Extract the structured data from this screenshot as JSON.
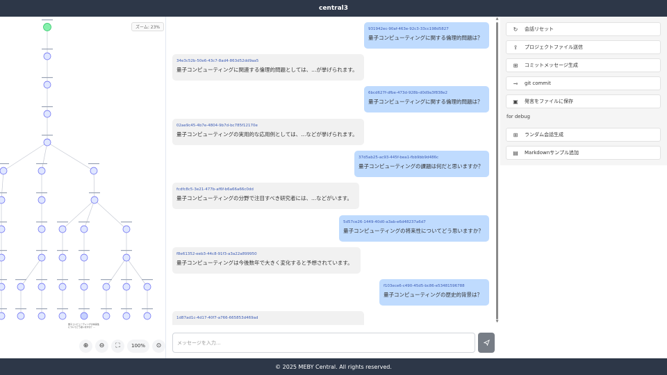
{
  "header": {
    "title": "central3"
  },
  "footer": {
    "text": "© 2025 MEBY Central. All rights reserved."
  },
  "tree": {
    "zoom_label": "ズーム: 23%",
    "controls": {
      "zoom_in": "⊕",
      "zoom_out": "⊖",
      "fit": "⛶",
      "percent": "100%",
      "center": "⊙"
    },
    "note": "量子コンピューティングの将来性についてどう思いますか？..."
  },
  "chat": {
    "messages": [
      {
        "role": "user",
        "id": "931942ec-90af-463e-92c3-33cc198d5827",
        "text": "量子コンピューティングに関する倫理的問題は？"
      },
      {
        "role": "bot",
        "id": "34e3c52b-50e6-43c7-8ad4-863d52dd9aa5",
        "text": "量子コンピューティングに関連する倫理的問題としては、...が挙げられます。"
      },
      {
        "role": "user",
        "id": "6bcd627f-dfbe-473d-928b-d0d9a3f838e2",
        "text": "量子コンピューティングに関する倫理的問題は？"
      },
      {
        "role": "bot",
        "id": "02ae9c45-4b7e-4804-9b7d-bc785f12170e",
        "text": "量子コンピューティングの実用的な応用例としては、...などが挙げられます。"
      },
      {
        "role": "user",
        "id": "37d5ab25-ac93-445f-bea1-fbb9bb9d486c",
        "text": "量子コンピューティングの課題は何だと思いますか？"
      },
      {
        "role": "bot",
        "id": "fcdfc8c5-3e21-477b-af6f-b6a66a66c0dd",
        "text": "量子コンピューティングの分野で注目すべき研究者には、...などがいます。"
      },
      {
        "role": "user",
        "id": "5d57ce26-1449-40d0-a3ab-e6d48237a6d7",
        "text": "量子コンピューティングの将来性についてどう思いますか？"
      },
      {
        "role": "bot",
        "id": "f8e61352-eeb3-44c8-91f3-a3a22a899950",
        "text": "量子コンピューティングは今後数年で大きく変化すると予想されています。"
      },
      {
        "role": "user",
        "id": "f103ece6-c490-45d5-bc86-e53481596788",
        "text": "量子コンピューティングの歴史的背景は？"
      },
      {
        "role": "bot",
        "id": "1d87ad1c-4d17-40f7-a766-665853d469ad",
        "text": ""
      }
    ],
    "input_placeholder": "メッセージを入力...",
    "send_icon": "paper-plane-icon"
  },
  "panel": {
    "buttons": [
      {
        "icon": "↻",
        "label": "会話リセット"
      },
      {
        "icon": "⇪",
        "label": "プロジェクトファイル送信"
      },
      {
        "icon": "⊞",
        "label": "コミットメッセージ生成"
      },
      {
        "icon": "⊸",
        "label": "git commit"
      },
      {
        "icon": "▣",
        "label": "発言をファイルに保存"
      }
    ],
    "debug_label": "for debug",
    "debug_buttons": [
      {
        "icon": "⊞",
        "label": "ランダム会話生成"
      },
      {
        "icon": "▤",
        "label": "Markdownサンプル追加"
      }
    ]
  },
  "colors": {
    "header_bg": "#2d3748",
    "user_bubble": "#bfdbfe",
    "bot_bubble": "#f1f1f1",
    "root_node": "#86efac",
    "node": "#e0e7ff"
  }
}
